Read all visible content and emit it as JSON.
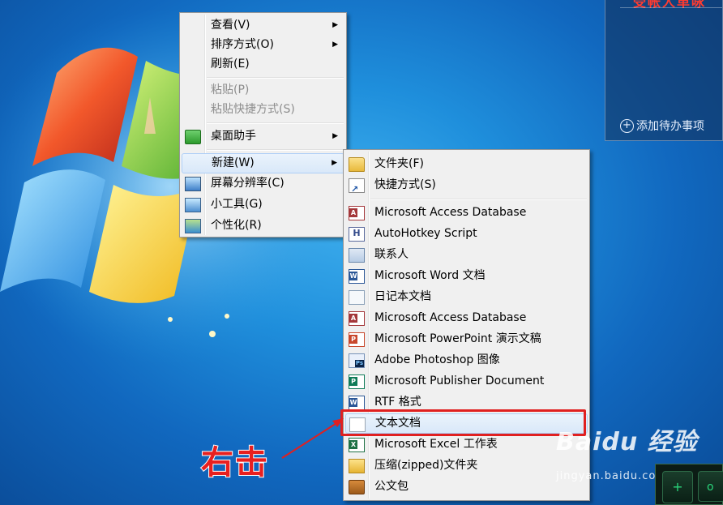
{
  "widget": {
    "red_text": "受帐人单咏",
    "add_label": "添加待办事项",
    "plus_glyph": "+"
  },
  "context_menu": {
    "items": [
      {
        "label": "查看(V)",
        "submenu": true,
        "disabled": false
      },
      {
        "label": "排序方式(O)",
        "submenu": true,
        "disabled": false
      },
      {
        "label": "刷新(E)",
        "submenu": false,
        "disabled": false
      },
      {
        "label": "粘贴(P)",
        "submenu": false,
        "disabled": true
      },
      {
        "label": "粘贴快捷方式(S)",
        "submenu": false,
        "disabled": true
      },
      {
        "label": "桌面助手",
        "submenu": true,
        "disabled": false,
        "icon": "desktop-assistant-icon"
      },
      {
        "label": "新建(W)",
        "submenu": true,
        "disabled": false,
        "highlighted": true
      },
      {
        "label": "屏幕分辨率(C)",
        "submenu": false,
        "disabled": false,
        "icon": "screen-resolution-icon"
      },
      {
        "label": "小工具(G)",
        "submenu": false,
        "disabled": false,
        "icon": "gadgets-icon"
      },
      {
        "label": "个性化(R)",
        "submenu": false,
        "disabled": false,
        "icon": "personalize-icon"
      }
    ],
    "arrow_glyph": "▶"
  },
  "new_submenu": {
    "items": [
      {
        "label": "文件夹(F)",
        "icon": "folder-icon"
      },
      {
        "label": "快捷方式(S)",
        "icon": "shortcut-icon"
      },
      {
        "label": "Microsoft Access Database",
        "icon": "access-icon"
      },
      {
        "label": "AutoHotkey Script",
        "icon": "autohotkey-icon"
      },
      {
        "label": "联系人",
        "icon": "contact-icon"
      },
      {
        "label": "Microsoft Word 文档",
        "icon": "word-icon"
      },
      {
        "label": "日记本文档",
        "icon": "journal-icon"
      },
      {
        "label": "Microsoft Access Database",
        "icon": "access-icon"
      },
      {
        "label": "Microsoft PowerPoint 演示文稿",
        "icon": "powerpoint-icon"
      },
      {
        "label": "Adobe Photoshop 图像",
        "icon": "photoshop-icon"
      },
      {
        "label": "Microsoft Publisher Document",
        "icon": "publisher-icon"
      },
      {
        "label": "RTF 格式",
        "icon": "rtf-icon"
      },
      {
        "label": "文本文档",
        "icon": "text-document-icon",
        "highlighted": true
      },
      {
        "label": "Microsoft Excel 工作表",
        "icon": "excel-icon"
      },
      {
        "label": "压缩(zipped)文件夹",
        "icon": "zip-folder-icon"
      },
      {
        "label": "公文包",
        "icon": "briefcase-icon"
      }
    ],
    "ahk_glyph": "H"
  },
  "annotation": {
    "label": "右击",
    "highlight_color": "#e02020"
  },
  "watermark": {
    "brand": "Baidu 经验",
    "url": "jingyan.baidu.com"
  },
  "tray": {
    "plus": "+",
    "dot": "o"
  }
}
